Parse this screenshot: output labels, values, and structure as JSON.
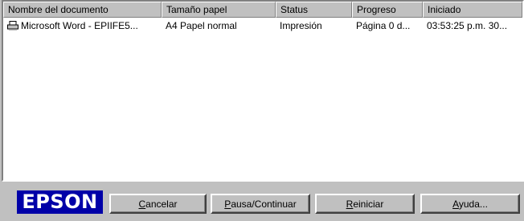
{
  "columns": [
    "Nombre del documento",
    "Tamaño papel",
    "Status",
    "Progreso",
    "Iniciado"
  ],
  "jobs": [
    {
      "icon": "printer-document-icon",
      "name": "Microsoft Word - EPIIFE5...",
      "paper": "A4 Papel normal",
      "status": "Impresión",
      "progress": "Página 0 d...",
      "started": "03:53:25 p.m. 30..."
    }
  ],
  "brand": {
    "logo_text": "EPSON",
    "color": "#0000a8"
  },
  "buttons": {
    "cancel": {
      "accel": "C",
      "rest": "ancelar"
    },
    "pause": {
      "accel": "P",
      "rest": "ausa/Continuar"
    },
    "restart": {
      "accel": "R",
      "rest": "einiciar"
    },
    "help": {
      "accel": "A",
      "rest": "yuda..."
    }
  }
}
